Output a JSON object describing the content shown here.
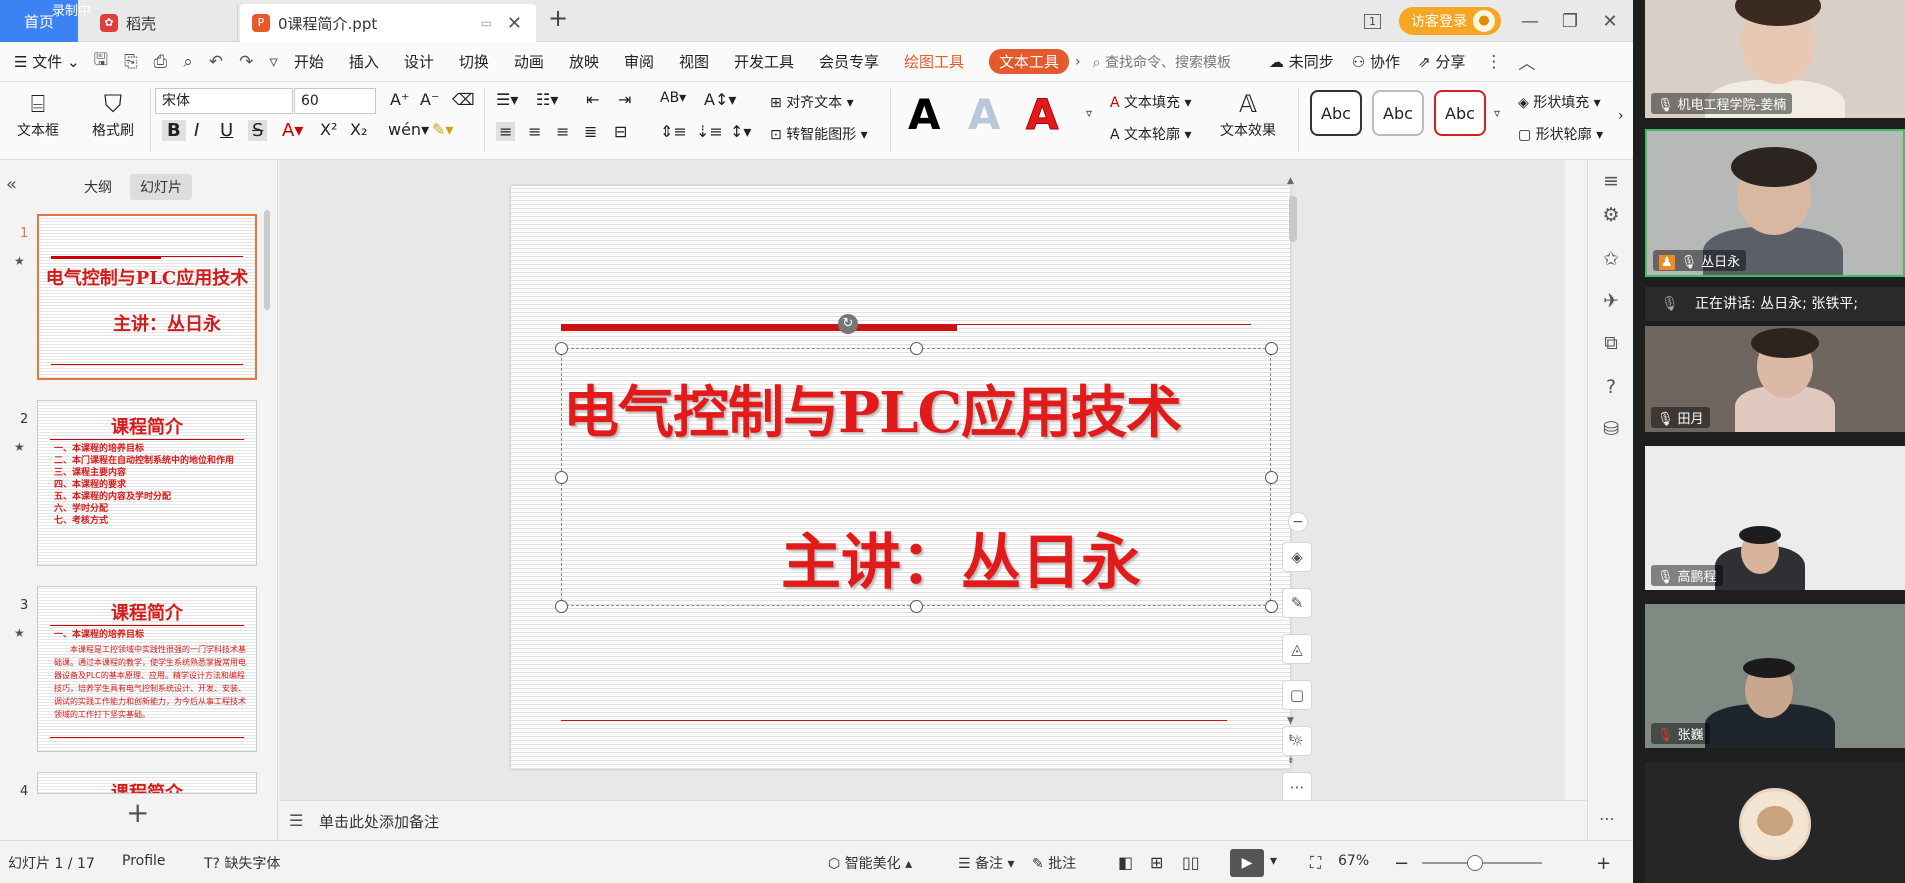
{
  "recording": "录制中",
  "tabs": {
    "home": "首页",
    "docer": "稻壳",
    "doc": "0课程简介.ppt",
    "doc_icon": "P"
  },
  "window": {
    "badge": "1",
    "login": "访客登录"
  },
  "menu": {
    "file": "文件",
    "items": [
      "开始",
      "插入",
      "设计",
      "切换",
      "动画",
      "放映",
      "审阅",
      "视图",
      "开发工具",
      "会员专享"
    ],
    "draw_tools": "绘图工具",
    "text_tools": "文本工具",
    "search": "查找命令、搜索模板",
    "unsync": "未同步",
    "collab": "协作",
    "share": "分享"
  },
  "ribbon": {
    "textbox": "文本框",
    "format_painter": "格式刷",
    "font": "宋体",
    "size": "60",
    "align_text": "对齐文本",
    "smart_shape": "转智能图形",
    "text_fill": "文本填充",
    "text_outline": "文本轮廓",
    "text_effect": "文本效果",
    "abc": "Abc",
    "shape_fill": "形状填充",
    "shape_outline": "形状轮廓"
  },
  "left_panel": {
    "outline": "大纲",
    "slides": "幻灯片",
    "thumb1": {
      "num": "1",
      "title": "电气控制与PLC应用技术",
      "sub": "主讲：丛日永"
    },
    "thumb2": {
      "num": "2",
      "title": "课程简介",
      "lines": [
        "一、本课程的培养目标",
        "二、本门课程在自动控制系统中的地位和作用",
        "三、课程主要内容",
        "四、本课程的要求",
        "五、本课程的内容及学时分配",
        "六、学时分配",
        "七、考核方式"
      ]
    },
    "thumb3": {
      "num": "3",
      "title": "课程简介",
      "heading": "一、本课程的培养目标",
      "para": "本课程是工控领域中实践性很强的一门学科技术基础课。通过本课程的教学，使学生系统熟悉掌握常用电器设备及PLC的基本原理、应用。精学设计方法和编程技巧，培养学生具有电气控制系统设计、开发、安装、调试的实践工作能力和创新能力，为今后从事工程技术领域的工作打下坚实基础。"
    },
    "thumb4": {
      "num": "4",
      "title": "课程简介"
    }
  },
  "slide": {
    "title": "电气控制与PLC应用技术",
    "subtitle": "主讲：丛日永"
  },
  "notes_placeholder": "单击此处添加备注",
  "status": {
    "slide_pos": "幻灯片 1 / 17",
    "profile": "Profile",
    "missing_font": "缺失字体",
    "beautify": "智能美化",
    "notes": "备注",
    "comments": "批注",
    "zoom": "67%"
  },
  "participants": [
    {
      "name": "机电工程学院-姜楠"
    },
    {
      "name": "丛日永"
    },
    {
      "name": "田月"
    },
    {
      "name": "高鹏程"
    },
    {
      "name": "张巍"
    }
  ],
  "speaking": "正在讲话: 丛日永; 张铁平;",
  "colors": {
    "accent": "#e45a2c",
    "slide_red": "#e21a1a",
    "home_tab": "#3d82f5"
  }
}
